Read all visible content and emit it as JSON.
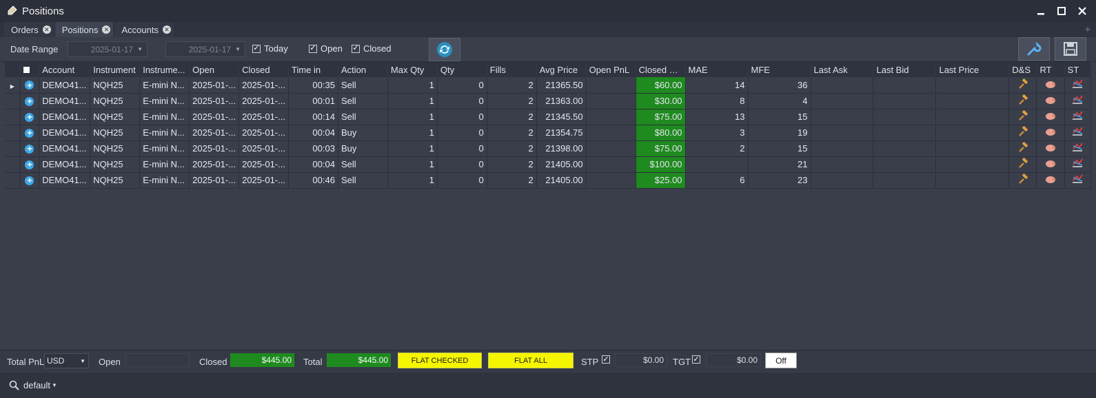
{
  "window": {
    "title": "Positions"
  },
  "tabs": [
    {
      "label": "Orders"
    },
    {
      "label": "Positions"
    },
    {
      "label": "Accounts"
    }
  ],
  "toolbar": {
    "date_range_label": "Date Range",
    "date_from": "2025-01-17",
    "date_to": "2025-01-17",
    "today_label": "Today",
    "open_label": "Open",
    "closed_label": "Closed"
  },
  "columns": [
    "Account",
    "Instrument",
    "Instrume...",
    "Open",
    "Closed",
    "Time in",
    "Action",
    "Max Qty",
    "Qty",
    "Fills",
    "Avg Price",
    "Open PnL",
    "Closed PnL",
    "MAE",
    "MFE",
    "Last Ask",
    "Last Bid",
    "Last Price",
    "D&S",
    "RT",
    "ST"
  ],
  "rows": [
    {
      "account": "DEMO41...",
      "instrument": "NQH25",
      "instrument_name": "E-mini N...",
      "open": "2025-01-...",
      "closed": "2025-01-...",
      "time_in": "00:35",
      "action": "Sell",
      "max_qty": "1",
      "qty": "0",
      "fills": "2",
      "avg_price": "21365.50",
      "open_pnl": "",
      "closed_pnl": "$60.00",
      "mae": "14",
      "mfe": "36",
      "last_ask": "",
      "last_bid": "",
      "last_price": ""
    },
    {
      "account": "DEMO41...",
      "instrument": "NQH25",
      "instrument_name": "E-mini N...",
      "open": "2025-01-...",
      "closed": "2025-01-...",
      "time_in": "00:01",
      "action": "Sell",
      "max_qty": "1",
      "qty": "0",
      "fills": "2",
      "avg_price": "21363.00",
      "open_pnl": "",
      "closed_pnl": "$30.00",
      "mae": "8",
      "mfe": "4",
      "last_ask": "",
      "last_bid": "",
      "last_price": ""
    },
    {
      "account": "DEMO41...",
      "instrument": "NQH25",
      "instrument_name": "E-mini N...",
      "open": "2025-01-...",
      "closed": "2025-01-...",
      "time_in": "00:14",
      "action": "Sell",
      "max_qty": "1",
      "qty": "0",
      "fills": "2",
      "avg_price": "21345.50",
      "open_pnl": "",
      "closed_pnl": "$75.00",
      "mae": "13",
      "mfe": "15",
      "last_ask": "",
      "last_bid": "",
      "last_price": ""
    },
    {
      "account": "DEMO41...",
      "instrument": "NQH25",
      "instrument_name": "E-mini N...",
      "open": "2025-01-...",
      "closed": "2025-01-...",
      "time_in": "00:04",
      "action": "Buy",
      "max_qty": "1",
      "qty": "0",
      "fills": "2",
      "avg_price": "21354.75",
      "open_pnl": "",
      "closed_pnl": "$80.00",
      "mae": "3",
      "mfe": "19",
      "last_ask": "",
      "last_bid": "",
      "last_price": ""
    },
    {
      "account": "DEMO41...",
      "instrument": "NQH25",
      "instrument_name": "E-mini N...",
      "open": "2025-01-...",
      "closed": "2025-01-...",
      "time_in": "00:03",
      "action": "Buy",
      "max_qty": "1",
      "qty": "0",
      "fills": "2",
      "avg_price": "21398.00",
      "open_pnl": "",
      "closed_pnl": "$75.00",
      "mae": "2",
      "mfe": "15",
      "last_ask": "",
      "last_bid": "",
      "last_price": ""
    },
    {
      "account": "DEMO41...",
      "instrument": "NQH25",
      "instrument_name": "E-mini N...",
      "open": "2025-01-...",
      "closed": "2025-01-...",
      "time_in": "00:04",
      "action": "Sell",
      "max_qty": "1",
      "qty": "0",
      "fills": "2",
      "avg_price": "21405.00",
      "open_pnl": "",
      "closed_pnl": "$100.00",
      "mae": "",
      "mfe": "21",
      "last_ask": "",
      "last_bid": "",
      "last_price": ""
    },
    {
      "account": "DEMO41...",
      "instrument": "NQH25",
      "instrument_name": "E-mini N...",
      "open": "2025-01-...",
      "closed": "2025-01-...",
      "time_in": "00:46",
      "action": "Sell",
      "max_qty": "1",
      "qty": "0",
      "fills": "2",
      "avg_price": "21405.00",
      "open_pnl": "",
      "closed_pnl": "$25.00",
      "mae": "6",
      "mfe": "23",
      "last_ask": "",
      "last_bid": "",
      "last_price": ""
    }
  ],
  "footer": {
    "total_pnl_label": "Total PnL",
    "currency": "USD",
    "open_label": "Open",
    "open_value": "",
    "closed_label": "Closed",
    "closed_value": "$445.00",
    "total_label": "Total",
    "total_value": "$445.00",
    "flat_checked_label": "FLAT CHECKED",
    "flat_all_label": "FLAT ALL",
    "stp_label": "STP",
    "stp_value": "$0.00",
    "tgt_label": "TGT",
    "tgt_value": "$0.00",
    "off_label": "Off"
  },
  "statusbar": {
    "profile": "default"
  },
  "colors": {
    "pnl_green": "#1f8a1f",
    "flat_yellow": "#f5f500",
    "accent_blue": "#3fa9e6"
  },
  "icons": {
    "app": "bottle-icon",
    "refresh": "refresh-icon",
    "settings": "wrench-icon",
    "save": "save-icon",
    "ds": "hammer-icon",
    "rt": "piggy-icon",
    "st": "chart-icon"
  }
}
